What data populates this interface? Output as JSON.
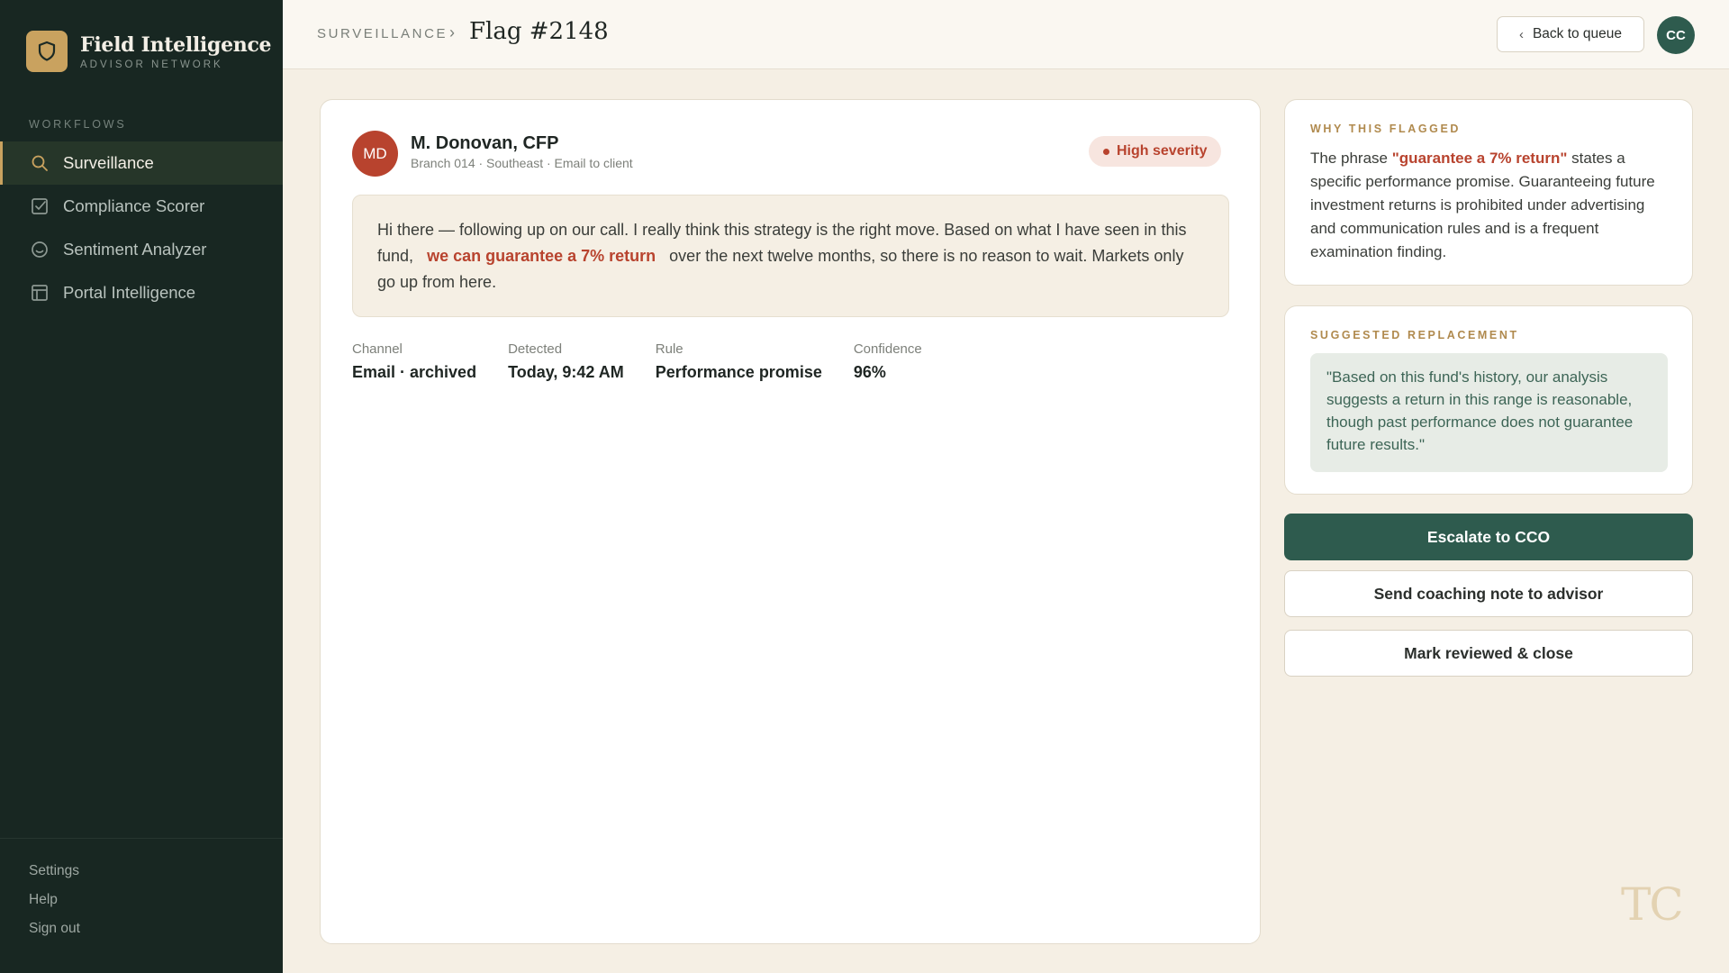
{
  "brand": {
    "title": "Field Intelligence",
    "subtitle": "ADVISOR NETWORK",
    "logo_icon": "shield-icon",
    "accent": "#c9a25f"
  },
  "sidebar": {
    "section_label": "WORKFLOWS",
    "items": [
      {
        "label": "Surveillance",
        "icon": "search-icon",
        "active": true
      },
      {
        "label": "Compliance Scorer",
        "icon": "check-square-icon",
        "active": false
      },
      {
        "label": "Sentiment Analyzer",
        "icon": "smile-icon",
        "active": false
      },
      {
        "label": "Portal Intelligence",
        "icon": "layout-icon",
        "active": false
      }
    ],
    "footer": [
      "Settings",
      "Help",
      "Sign out"
    ]
  },
  "header": {
    "breadcrumb": "SURVEILLANCE",
    "title": "Flag #2148",
    "back_label": "Back to queue",
    "user_initials": "CC"
  },
  "flag": {
    "advisor_initials": "MD",
    "advisor_name": "M. Donovan, CFP",
    "advisor_meta": "Branch 014 · Southeast · Email to client",
    "severity": "High severity",
    "message_before": "Hi there — following up on our call. I really think this strategy is the right move. Based on what I have seen in this fund,",
    "message_highlight": "we can guarantee a 7% return",
    "message_after": "over the next twelve months, so there is no reason to wait. Markets only go up from here.",
    "meta": [
      {
        "label": "Channel",
        "value": "Email · archived"
      },
      {
        "label": "Detected",
        "value": "Today, 9:42 AM"
      },
      {
        "label": "Rule",
        "value": "Performance promise"
      },
      {
        "label": "Confidence",
        "value": "96%"
      }
    ]
  },
  "why": {
    "label": "WHY THIS FLAGGED",
    "text_before": "The phrase",
    "phrase": "\"guarantee a 7% return\"",
    "text_after": "states a specific performance promise. Guaranteeing future investment returns is prohibited under advertising and communication rules and is a frequent examination finding."
  },
  "replacement": {
    "label": "SUGGESTED REPLACEMENT",
    "text": "\"Based on this fund's history, our analysis suggests a return in this range is reasonable, though past performance does not guarantee future results.\""
  },
  "actions": {
    "escalate": "Escalate to CCO",
    "coach": "Send coaching note to advisor",
    "close": "Mark reviewed & close"
  },
  "watermark": "TC"
}
